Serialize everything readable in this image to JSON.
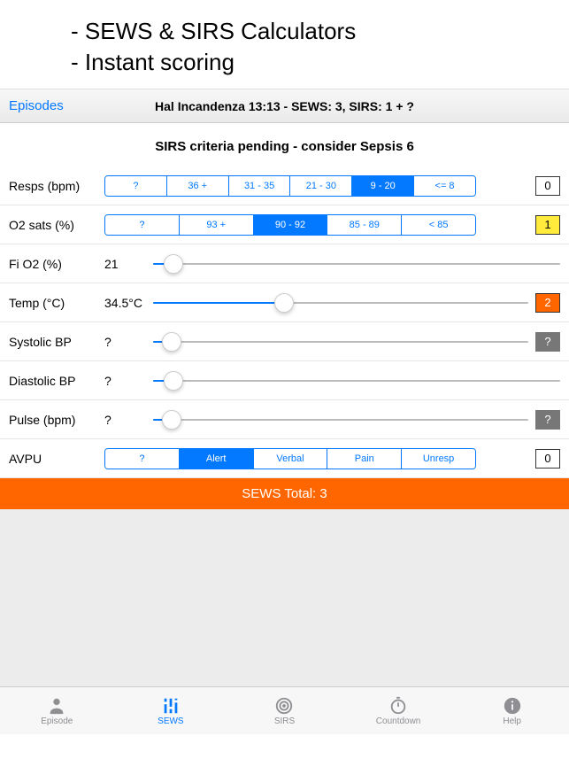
{
  "promo": {
    "l1": "- SEWS & SIRS Calculators",
    "l2": "- Instant scoring"
  },
  "nav": {
    "back": "Episodes",
    "title": "Hal Incandenza 13:13 - SEWS: 3, SIRS: 1 + ?"
  },
  "alert": "SIRS criteria pending - consider Sepsis 6",
  "rows": {
    "resps": {
      "label": "Resps (bpm)",
      "opts": [
        "?",
        "36 +",
        "31 - 35",
        "21 - 30",
        "9 - 20",
        "<= 8"
      ],
      "sel": 4,
      "score": "0",
      "scoreClass": "white"
    },
    "o2": {
      "label": "O2 sats (%)",
      "opts": [
        "?",
        "93 +",
        "90 - 92",
        "85 - 89",
        "< 85"
      ],
      "sel": 2,
      "score": "1",
      "scoreClass": "yellow"
    },
    "fio2": {
      "label": "Fi O2 (%)",
      "value": "21",
      "pos": 5
    },
    "temp": {
      "label": "Temp (°C)",
      "value": "34.5°C",
      "pos": 35,
      "score": "2",
      "scoreClass": "orange"
    },
    "sys": {
      "label": "Systolic BP",
      "value": "?",
      "pos": 5,
      "score": "?",
      "scoreClass": "gray"
    },
    "dia": {
      "label": "Diastolic BP",
      "value": "?",
      "pos": 5
    },
    "pulse": {
      "label": "Pulse (bpm)",
      "value": "?",
      "pos": 5,
      "score": "?",
      "scoreClass": "gray"
    },
    "avpu": {
      "label": "AVPU",
      "opts": [
        "?",
        "Alert",
        "Verbal",
        "Pain",
        "Unresp"
      ],
      "sel": 1,
      "score": "0",
      "scoreClass": "white"
    }
  },
  "total": "SEWS Total: 3",
  "tabs": [
    {
      "label": "Episode"
    },
    {
      "label": "SEWS"
    },
    {
      "label": "SIRS"
    },
    {
      "label": "Countdown"
    },
    {
      "label": "Help"
    }
  ],
  "activeTab": 1
}
